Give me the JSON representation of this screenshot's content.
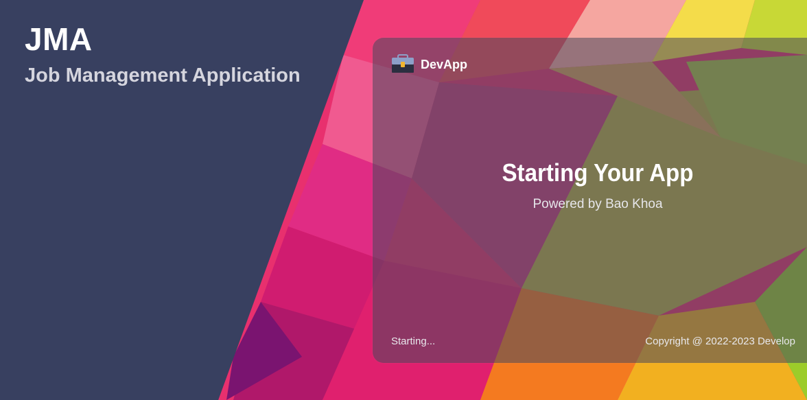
{
  "brand": {
    "title": "JMA",
    "subtitle": "Job Management Application"
  },
  "splash": {
    "app_name": "DevApp",
    "logo_icon": "briefcase-icon",
    "headline": "Starting Your App",
    "powered_by": "Powered by Bao Khoa",
    "status": "Starting...",
    "copyright": "Copyright @ 2022-2023 Develop"
  },
  "colors": {
    "left_panel": "#384060",
    "accent_pink": "#e0206e",
    "accent_orange": "#f47a20",
    "accent_yellow": "#f2d020",
    "accent_green": "#9ccc2a",
    "logo_body": "#8da0c8",
    "logo_clasp": "#f2b630"
  }
}
